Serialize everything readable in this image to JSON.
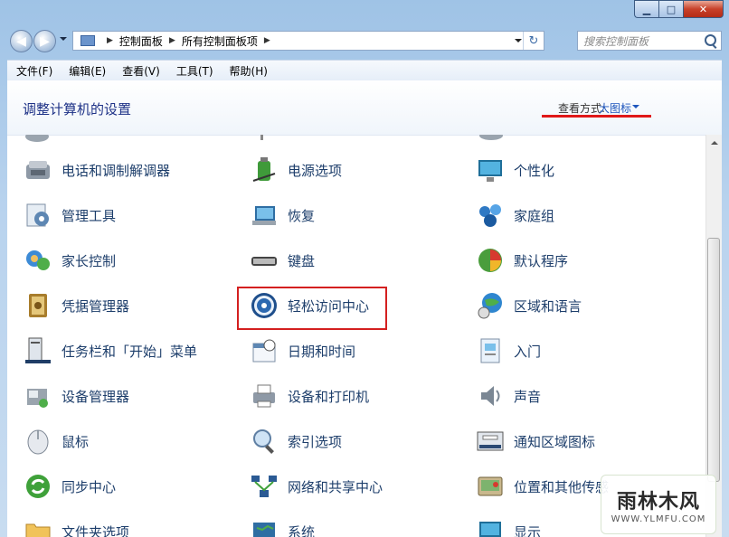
{
  "window": {
    "controls": {
      "minimize": "▁",
      "maximize": "□",
      "close": "✕"
    }
  },
  "address_bar": {
    "crumbs": [
      "控制面板",
      "所有控制面板项"
    ],
    "crumb_separator": "▶",
    "refresh_glyph": "↻"
  },
  "search": {
    "placeholder": "搜索控制面板"
  },
  "menu": [
    "文件(F)",
    "编辑(E)",
    "查看(V)",
    "工具(T)",
    "帮助(H)"
  ],
  "header": {
    "title": "调整计算机的设置",
    "view_by_label": "查看方式:",
    "view_by_value": "大图标"
  },
  "items": [
    {
      "label": "电话和调制解调器",
      "icon": "phone-modem-icon"
    },
    {
      "label": "电源选项",
      "icon": "power-options-icon"
    },
    {
      "label": "个性化",
      "icon": "personalization-icon"
    },
    {
      "label": "管理工具",
      "icon": "admin-tools-icon"
    },
    {
      "label": "恢复",
      "icon": "recovery-icon"
    },
    {
      "label": "家庭组",
      "icon": "homegroup-icon"
    },
    {
      "label": "家长控制",
      "icon": "parental-controls-icon"
    },
    {
      "label": "键盘",
      "icon": "keyboard-icon"
    },
    {
      "label": "默认程序",
      "icon": "default-programs-icon"
    },
    {
      "label": "凭据管理器",
      "icon": "credential-manager-icon"
    },
    {
      "label": "轻松访问中心",
      "icon": "ease-of-access-icon"
    },
    {
      "label": "区域和语言",
      "icon": "region-language-icon"
    },
    {
      "label": "任务栏和「开始」菜单",
      "icon": "taskbar-start-menu-icon"
    },
    {
      "label": "日期和时间",
      "icon": "date-time-icon"
    },
    {
      "label": "入门",
      "icon": "getting-started-icon"
    },
    {
      "label": "设备管理器",
      "icon": "device-manager-icon"
    },
    {
      "label": "设备和打印机",
      "icon": "devices-printers-icon"
    },
    {
      "label": "声音",
      "icon": "sound-icon"
    },
    {
      "label": "鼠标",
      "icon": "mouse-icon"
    },
    {
      "label": "索引选项",
      "icon": "indexing-options-icon"
    },
    {
      "label": "通知区域图标",
      "icon": "notification-area-icon"
    },
    {
      "label": "同步中心",
      "icon": "sync-center-icon"
    },
    {
      "label": "网络和共享中心",
      "icon": "network-sharing-icon"
    },
    {
      "label": "位置和其他传感",
      "icon": "location-sensors-icon"
    },
    {
      "label": "文件夹选项",
      "icon": "folder-options-icon"
    },
    {
      "label": "系统",
      "icon": "system-icon"
    },
    {
      "label": "显示",
      "icon": "display-icon"
    }
  ],
  "watermark": {
    "line1": "雨林木风",
    "line2": "WWW.YLMFU.COM"
  },
  "colors": {
    "link": "#1d3e6b",
    "accent_red": "#d42020",
    "title_blue": "#1e3287"
  }
}
